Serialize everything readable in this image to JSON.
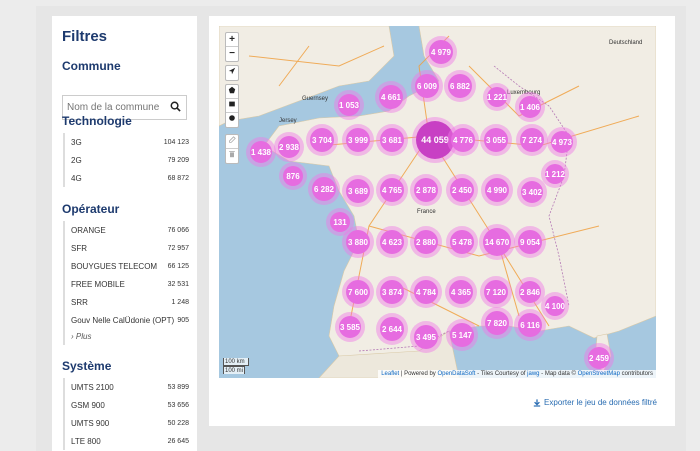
{
  "sidebar": {
    "title": "Filtres",
    "commune": {
      "title": "Commune",
      "placeholder": "Nom de la commune"
    },
    "technologie": {
      "title": "Technologie",
      "items": [
        {
          "label": "3G",
          "count": "104 123"
        },
        {
          "label": "2G",
          "count": "79 209"
        },
        {
          "label": "4G",
          "count": "68 872"
        }
      ]
    },
    "operateur": {
      "title": "Opérateur",
      "items": [
        {
          "label": "ORANGE",
          "count": "76 066"
        },
        {
          "label": "SFR",
          "count": "72 957"
        },
        {
          "label": "BOUYGUES TELECOM",
          "count": "66 125"
        },
        {
          "label": "FREE MOBILE",
          "count": "32 531"
        },
        {
          "label": "SRR",
          "count": "1 248"
        },
        {
          "label": "Gouv Nelle CalÜdonie (OPT)",
          "count": "905"
        }
      ],
      "more": "› Plus"
    },
    "systeme": {
      "title": "Système",
      "items": [
        {
          "label": "UMTS 2100",
          "count": "53 899"
        },
        {
          "label": "GSM 900",
          "count": "53 656"
        },
        {
          "label": "UMTS 900",
          "count": "50 228"
        },
        {
          "label": "LTE 800",
          "count": "26 645"
        }
      ]
    }
  },
  "map": {
    "controls": {
      "zoom_in": "+",
      "zoom_out": "−"
    },
    "labels": {
      "france": "France",
      "deutschland": "Deutschland",
      "luxembourg": "Luxembourg",
      "jersey": "Jersey",
      "guernsey": "Guernsey"
    },
    "clusters": [
      {
        "label": "4 979"
      },
      {
        "label": "6 009"
      },
      {
        "label": "6 882"
      },
      {
        "label": "4 661"
      },
      {
        "label": "1 053"
      },
      {
        "label": "1 221"
      },
      {
        "label": "1 406"
      },
      {
        "label": "3 704"
      },
      {
        "label": "3 999"
      },
      {
        "label": "3 681"
      },
      {
        "label": "44 059"
      },
      {
        "label": "4 776"
      },
      {
        "label": "3 055"
      },
      {
        "label": "7 274"
      },
      {
        "label": "4 973"
      },
      {
        "label": "1 438"
      },
      {
        "label": "2 938"
      },
      {
        "label": "876"
      },
      {
        "label": "6 282"
      },
      {
        "label": "3 689"
      },
      {
        "label": "4 765"
      },
      {
        "label": "2 878"
      },
      {
        "label": "2 450"
      },
      {
        "label": "4 990"
      },
      {
        "label": "3 402"
      },
      {
        "label": "1 212"
      },
      {
        "label": "131"
      },
      {
        "label": "3 880"
      },
      {
        "label": "4 623"
      },
      {
        "label": "2 880"
      },
      {
        "label": "5 478"
      },
      {
        "label": "14 670"
      },
      {
        "label": "9 054"
      },
      {
        "label": "7 600"
      },
      {
        "label": "3 874"
      },
      {
        "label": "4 784"
      },
      {
        "label": "4 365"
      },
      {
        "label": "7 120"
      },
      {
        "label": "2 846"
      },
      {
        "label": "4 100"
      },
      {
        "label": "3 585"
      },
      {
        "label": "2 644"
      },
      {
        "label": "3 495"
      },
      {
        "label": "5 147"
      },
      {
        "label": "7 820"
      },
      {
        "label": "6 116"
      },
      {
        "label": "2 459"
      }
    ],
    "scale": {
      "km": "100 km",
      "mi": "100 mi"
    },
    "attribution": {
      "leaflet": "Leaflet",
      "text1": " | Powered by ",
      "ods": "OpenDataSoft",
      "text2": " - Tiles Courtesy of ",
      "jawg": "jawg",
      "text3": " - Map data © ",
      "osm": "OpenStreetMap",
      "text4": " contributors"
    }
  },
  "export": {
    "label": "Exporter le jeu de données filtré"
  },
  "colors": {
    "cluster": "#e66ce0",
    "cluster_big": "#c840c4",
    "sea": "#a6c8e0",
    "land": "#f1ede4",
    "accent": "#1d3a6e",
    "link": "#2a6db2"
  }
}
